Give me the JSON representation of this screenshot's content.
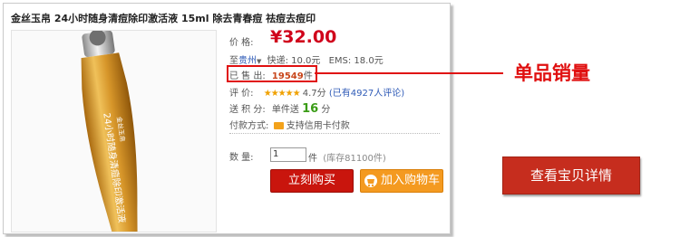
{
  "product": {
    "title": "金丝玉帛 24小时随身清痘除印激活液 15ml 除去青春痘 祛痘去痘印"
  },
  "price": {
    "label": "价 格:",
    "value": "¥32.00"
  },
  "shipping": {
    "to_label": "至",
    "location": "贵州",
    "express": "快递: 10.0元",
    "ems": "EMS: 18.0元"
  },
  "sales": {
    "label": "已 售 出:",
    "count": "19549",
    "unit": "件"
  },
  "rating": {
    "label": "评 价:",
    "stars": "★★★★★",
    "score": "4.7分",
    "reviews": "(已有4927人评论)"
  },
  "points": {
    "label": "送 积 分:",
    "prefix": "单件送",
    "value": "16",
    "unit": "分"
  },
  "payment": {
    "label": "付款方式:",
    "value": "支持信用卡付款"
  },
  "quantity": {
    "label": "数 量:",
    "value": "1",
    "unit": "件",
    "stock": "(库存81100件)"
  },
  "buttons": {
    "buy_now": "立刻购买",
    "add_cart": "加入购物车",
    "view_details": "查看宝贝详情"
  },
  "callout": {
    "text": "单品销量"
  },
  "bottle": {
    "text": "24小时随身清痘除印激活液",
    "brand": "金丝玉帛"
  },
  "colors": {
    "price_red": "#d0021b",
    "accent_red": "#e01010",
    "buy_red": "#c9150d",
    "cart_orange": "#f49a20",
    "gold": "#d99a25"
  }
}
